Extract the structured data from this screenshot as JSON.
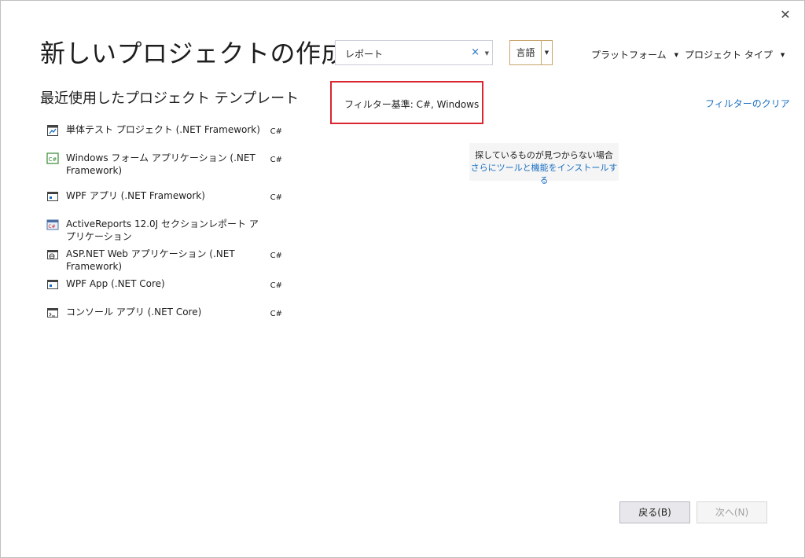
{
  "window": {
    "close_glyph": "✕",
    "title": "新しいプロジェクトの作成"
  },
  "recent": {
    "heading": "最近使用したプロジェクト テンプレート",
    "items": [
      {
        "label": "単体テスト プロジェクト (.NET Framework)",
        "lang": "C#",
        "icon": "unit-test-icon"
      },
      {
        "label": "Windows フォーム アプリケーション (.NET Framework)",
        "lang": "C#",
        "icon": "windows-forms-icon"
      },
      {
        "label": "WPF アプリ (.NET Framework)",
        "lang": "C#",
        "icon": "wpf-app-icon"
      },
      {
        "label": "ActiveReports 12.0J セクションレポート アプリケーション",
        "lang": "",
        "icon": "activereports-icon"
      },
      {
        "label": "ASP.NET Web アプリケーション (.NET Framework)",
        "lang": "C#",
        "icon": "aspnet-web-icon"
      },
      {
        "label": "WPF App (.NET Core)",
        "lang": "C#",
        "icon": "wpf-app-core-icon"
      },
      {
        "label": "コンソール アプリ (.NET Core)",
        "lang": "C#",
        "icon": "console-app-icon"
      }
    ]
  },
  "search": {
    "value": "レポート",
    "clear_glyph": "×",
    "dropdown_glyph": "▼"
  },
  "filters": {
    "language_label": "言語",
    "platform_label": "プラットフォーム",
    "project_type_label": "プロジェクト タイプ",
    "caret_glyph": "▼",
    "applied_text": "フィルター基準: C#, Windows",
    "clear_link": "フィルターのクリア"
  },
  "hint": {
    "text": "探しているものが見つからない場合",
    "link": "さらにツールと機能をインストールする"
  },
  "buttons": {
    "back": "戻る(B)",
    "next": "次へ(N)"
  },
  "colors": {
    "accent": "#1b6fc2",
    "highlight_border": "#d9262f",
    "lang_button_border": "#c9a46b"
  }
}
